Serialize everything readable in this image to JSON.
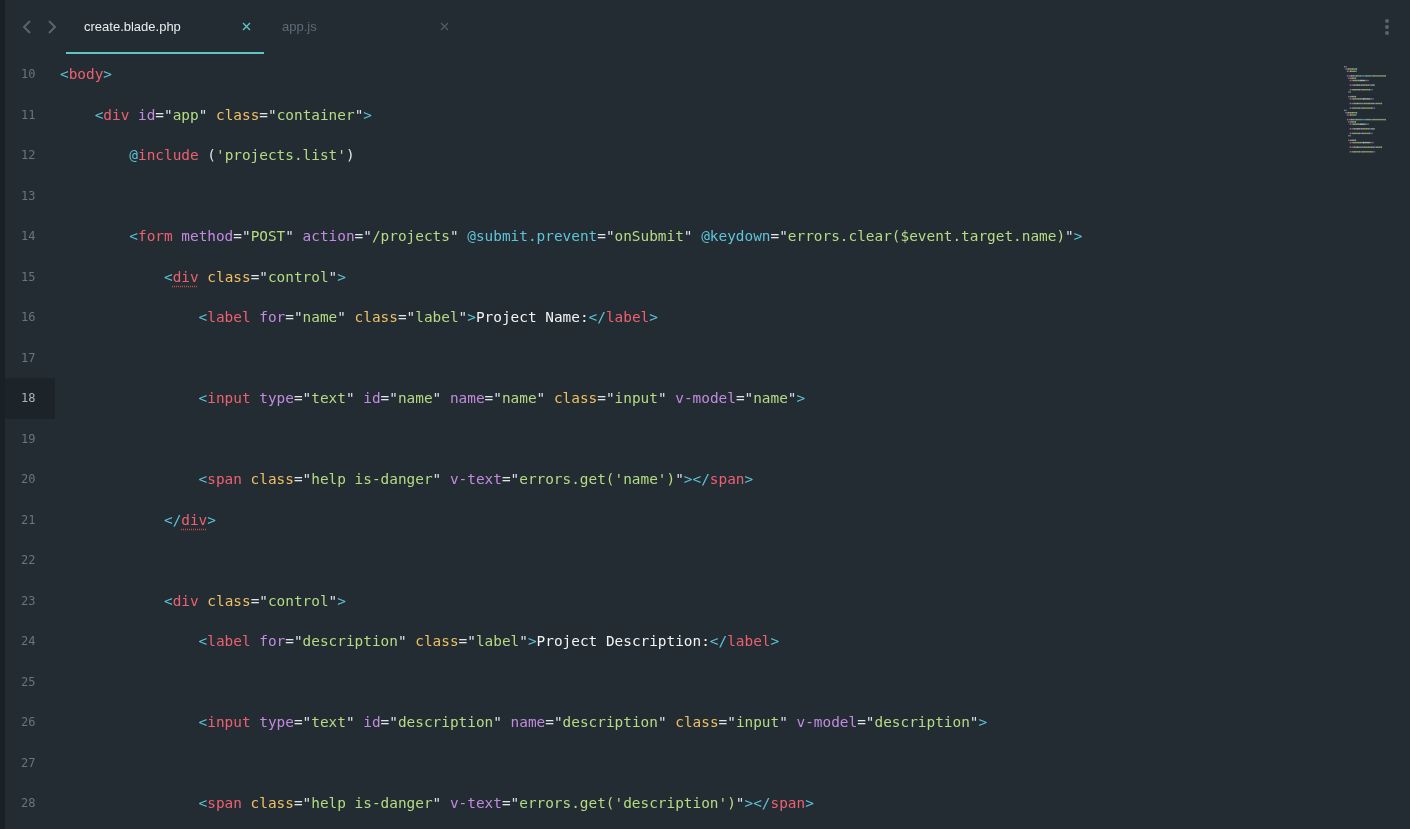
{
  "tabs": [
    {
      "label": "create.blade.php",
      "selected": true
    },
    {
      "label": "app.js",
      "selected": false
    }
  ],
  "editor": {
    "lines": [
      {
        "number": "10",
        "current": false,
        "tokens": [
          {
            "kind": "bracket",
            "text": "<"
          },
          {
            "kind": "tag",
            "text": "body"
          },
          {
            "kind": "bracket",
            "text": ">"
          }
        ]
      },
      {
        "number": "11",
        "current": false,
        "tokens": [
          {
            "kind": "bracket",
            "text": "    <"
          },
          {
            "kind": "tag",
            "text": "div"
          },
          {
            "kind": "attr",
            "text": " id"
          },
          {
            "kind": "punct",
            "text": "=\""
          },
          {
            "kind": "string",
            "text": "app"
          },
          {
            "kind": "punct",
            "text": "\""
          },
          {
            "kind": "class-attr",
            "text": " class"
          },
          {
            "kind": "punct",
            "text": "=\""
          },
          {
            "kind": "string",
            "text": "container"
          },
          {
            "kind": "punct",
            "text": "\""
          },
          {
            "kind": "bracket",
            "text": ">"
          }
        ]
      },
      {
        "number": "12",
        "current": false,
        "tokens": [
          {
            "kind": "directive",
            "text": "        @"
          },
          {
            "kind": "tag",
            "text": "include"
          },
          {
            "kind": "punct",
            "text": " ("
          },
          {
            "kind": "string",
            "text": "'projects.list'"
          },
          {
            "kind": "punct",
            "text": ")"
          }
        ]
      },
      {
        "number": "13",
        "current": false
      },
      {
        "number": "14",
        "current": false,
        "tokens": [
          {
            "kind": "bracket",
            "text": "        <"
          },
          {
            "kind": "tag",
            "text": "form"
          },
          {
            "kind": "attr",
            "text": " method"
          },
          {
            "kind": "punct",
            "text": "=\""
          },
          {
            "kind": "string",
            "text": "POST"
          },
          {
            "kind": "punct",
            "text": "\""
          },
          {
            "kind": "attr",
            "text": " action"
          },
          {
            "kind": "punct",
            "text": "=\""
          },
          {
            "kind": "string",
            "text": "/projects"
          },
          {
            "kind": "punct",
            "text": "\""
          },
          {
            "kind": "directive",
            "text": " @submit.prevent"
          },
          {
            "kind": "punct",
            "text": "=\""
          },
          {
            "kind": "string",
            "text": "onSubmit"
          },
          {
            "kind": "punct",
            "text": "\""
          },
          {
            "kind": "directive",
            "text": " @keydown"
          },
          {
            "kind": "punct",
            "text": "=\""
          },
          {
            "kind": "string",
            "text": "errors.clear($event.target.name)"
          },
          {
            "kind": "punct",
            "text": "\""
          },
          {
            "kind": "bracket",
            "text": ">"
          }
        ]
      },
      {
        "number": "15",
        "current": false,
        "tokens": [
          {
            "kind": "bracket",
            "text": "            <"
          },
          {
            "kind": "tag-warning",
            "text": "div"
          },
          {
            "kind": "class-attr",
            "text": " class"
          },
          {
            "kind": "punct",
            "text": "=\""
          },
          {
            "kind": "string",
            "text": "control"
          },
          {
            "kind": "punct",
            "text": "\""
          },
          {
            "kind": "bracket",
            "text": ">"
          }
        ]
      },
      {
        "number": "16",
        "current": false,
        "tokens": [
          {
            "kind": "bracket",
            "text": "                <"
          },
          {
            "kind": "tag",
            "text": "label"
          },
          {
            "kind": "attr",
            "text": " for"
          },
          {
            "kind": "punct",
            "text": "=\""
          },
          {
            "kind": "string",
            "text": "name"
          },
          {
            "kind": "punct",
            "text": "\""
          },
          {
            "kind": "class-attr",
            "text": " class"
          },
          {
            "kind": "punct",
            "text": "=\""
          },
          {
            "kind": "string",
            "text": "label"
          },
          {
            "kind": "punct",
            "text": "\""
          },
          {
            "kind": "bracket",
            "text": ">"
          },
          {
            "kind": "text",
            "text": "Project Name:"
          },
          {
            "kind": "bracket",
            "text": "</"
          },
          {
            "kind": "tag",
            "text": "label"
          },
          {
            "kind": "bracket",
            "text": ">"
          }
        ]
      },
      {
        "number": "17",
        "current": false
      },
      {
        "number": "18",
        "current": true,
        "tokens": [
          {
            "kind": "bracket",
            "text": "                <"
          },
          {
            "kind": "tag",
            "text": "input"
          },
          {
            "kind": "attr",
            "text": " type"
          },
          {
            "kind": "punct",
            "text": "=\""
          },
          {
            "kind": "string",
            "text": "text"
          },
          {
            "kind": "punct",
            "text": "\""
          },
          {
            "kind": "attr",
            "text": " id"
          },
          {
            "kind": "punct",
            "text": "=\""
          },
          {
            "kind": "string",
            "text": "name"
          },
          {
            "kind": "punct",
            "text": "\""
          },
          {
            "kind": "attr",
            "text": " name"
          },
          {
            "kind": "punct",
            "text": "=\""
          },
          {
            "kind": "string",
            "text": "name"
          },
          {
            "kind": "punct",
            "text": "\""
          },
          {
            "kind": "class-attr",
            "text": " class"
          },
          {
            "kind": "punct",
            "text": "=\""
          },
          {
            "kind": "string",
            "text": "input"
          },
          {
            "kind": "punct",
            "text": "\""
          },
          {
            "kind": "attr",
            "text": " v-model"
          },
          {
            "kind": "punct",
            "text": "=\""
          },
          {
            "kind": "string",
            "text": "name"
          },
          {
            "kind": "punct",
            "text": "\""
          },
          {
            "kind": "bracket",
            "text": ">"
          }
        ]
      },
      {
        "number": "19",
        "current": false
      },
      {
        "number": "20",
        "current": false,
        "tokens": [
          {
            "kind": "bracket",
            "text": "                <"
          },
          {
            "kind": "tag",
            "text": "span"
          },
          {
            "kind": "class-attr",
            "text": " class"
          },
          {
            "kind": "punct",
            "text": "=\""
          },
          {
            "kind": "string",
            "text": "help is-danger"
          },
          {
            "kind": "punct",
            "text": "\""
          },
          {
            "kind": "attr",
            "text": " v-text"
          },
          {
            "kind": "punct",
            "text": "=\""
          },
          {
            "kind": "string",
            "text": "errors.get('name')"
          },
          {
            "kind": "punct",
            "text": "\""
          },
          {
            "kind": "bracket",
            "text": "></"
          },
          {
            "kind": "tag",
            "text": "span"
          },
          {
            "kind": "bracket",
            "text": ">"
          }
        ]
      },
      {
        "number": "21",
        "current": false,
        "tokens": [
          {
            "kind": "bracket",
            "text": "            </"
          },
          {
            "kind": "tag-warning",
            "text": "div"
          },
          {
            "kind": "bracket",
            "text": ">"
          }
        ]
      },
      {
        "number": "22",
        "current": false
      },
      {
        "number": "23",
        "current": false,
        "tokens": [
          {
            "kind": "bracket",
            "text": "            <"
          },
          {
            "kind": "tag",
            "text": "div"
          },
          {
            "kind": "class-attr",
            "text": " class"
          },
          {
            "kind": "punct",
            "text": "=\""
          },
          {
            "kind": "string",
            "text": "control"
          },
          {
            "kind": "punct",
            "text": "\""
          },
          {
            "kind": "bracket",
            "text": ">"
          }
        ]
      },
      {
        "number": "24",
        "current": false,
        "tokens": [
          {
            "kind": "bracket",
            "text": "                <"
          },
          {
            "kind": "tag",
            "text": "label"
          },
          {
            "kind": "attr",
            "text": " for"
          },
          {
            "kind": "punct",
            "text": "=\""
          },
          {
            "kind": "string",
            "text": "description"
          },
          {
            "kind": "punct",
            "text": "\""
          },
          {
            "kind": "class-attr",
            "text": " class"
          },
          {
            "kind": "punct",
            "text": "=\""
          },
          {
            "kind": "string",
            "text": "label"
          },
          {
            "kind": "punct",
            "text": "\""
          },
          {
            "kind": "bracket",
            "text": ">"
          },
          {
            "kind": "text",
            "text": "Project Description:"
          },
          {
            "kind": "bracket",
            "text": "</"
          },
          {
            "kind": "tag",
            "text": "label"
          },
          {
            "kind": "bracket",
            "text": ">"
          }
        ]
      },
      {
        "number": "25",
        "current": false
      },
      {
        "number": "26",
        "current": false,
        "tokens": [
          {
            "kind": "bracket",
            "text": "                <"
          },
          {
            "kind": "tag",
            "text": "input"
          },
          {
            "kind": "attr",
            "text": " type"
          },
          {
            "kind": "punct",
            "text": "=\""
          },
          {
            "kind": "string",
            "text": "text"
          },
          {
            "kind": "punct",
            "text": "\""
          },
          {
            "kind": "attr",
            "text": " id"
          },
          {
            "kind": "punct",
            "text": "=\""
          },
          {
            "kind": "string",
            "text": "description"
          },
          {
            "kind": "punct",
            "text": "\""
          },
          {
            "kind": "attr",
            "text": " name"
          },
          {
            "kind": "punct",
            "text": "=\""
          },
          {
            "kind": "string",
            "text": "description"
          },
          {
            "kind": "punct",
            "text": "\""
          },
          {
            "kind": "class-attr",
            "text": " class"
          },
          {
            "kind": "punct",
            "text": "=\""
          },
          {
            "kind": "string",
            "text": "input"
          },
          {
            "kind": "punct",
            "text": "\""
          },
          {
            "kind": "attr",
            "text": " v-model"
          },
          {
            "kind": "punct",
            "text": "=\""
          },
          {
            "kind": "string",
            "text": "description"
          },
          {
            "kind": "punct",
            "text": "\""
          },
          {
            "kind": "bracket",
            "text": ">"
          }
        ]
      },
      {
        "number": "27",
        "current": false
      },
      {
        "number": "28",
        "current": false,
        "tokens": [
          {
            "kind": "bracket",
            "text": "                <"
          },
          {
            "kind": "tag",
            "text": "span"
          },
          {
            "kind": "class-attr",
            "text": " class"
          },
          {
            "kind": "punct",
            "text": "=\""
          },
          {
            "kind": "string",
            "text": "help is-danger"
          },
          {
            "kind": "punct",
            "text": "\""
          },
          {
            "kind": "attr",
            "text": " v-text"
          },
          {
            "kind": "punct",
            "text": "=\""
          },
          {
            "kind": "string",
            "text": "errors.get('description')"
          },
          {
            "kind": "punct",
            "text": "\""
          },
          {
            "kind": "bracket",
            "text": "></"
          },
          {
            "kind": "tag",
            "text": "span"
          },
          {
            "kind": "bracket",
            "text": ">"
          }
        ]
      }
    ]
  }
}
